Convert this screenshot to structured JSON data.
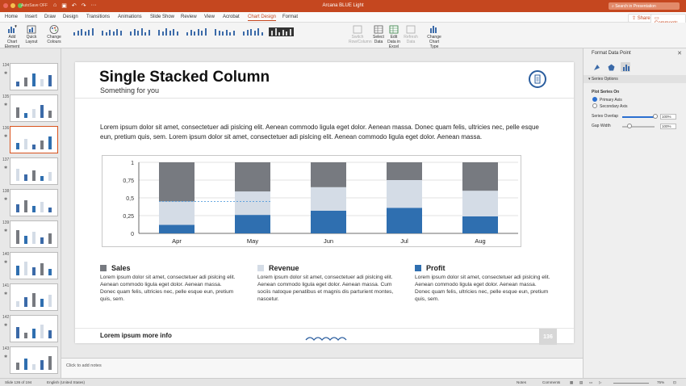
{
  "window": {
    "title": "Arcana BLUE Light",
    "autosave_label": "AutoSave",
    "autosave_state": "OFF",
    "search_placeholder": "Search in Presentation",
    "share_label": "Share",
    "comments_label": "Comments"
  },
  "tabs": [
    "Home",
    "Insert",
    "Draw",
    "Design",
    "Transitions",
    "Animations",
    "Slide Show",
    "Review",
    "View",
    "Acrobat",
    "Chart Design",
    "Format"
  ],
  "active_tab": "Chart Design",
  "ribbon": {
    "add_chart_element": "Add Chart Element",
    "quick_layout": "Quick Layout",
    "change_colours": "Change Colours",
    "switch_row_column": "Switch Row/Column",
    "select_data": "Select Data",
    "edit_data_in_excel": "Edit Data in Excel",
    "refresh_data": "Refresh Data",
    "change_chart_type": "Change Chart Type"
  },
  "thumbnails": [
    {
      "num": "134",
      "star": "✱"
    },
    {
      "num": "135",
      "star": "✱"
    },
    {
      "num": "136",
      "star": "✱",
      "selected": true
    },
    {
      "num": "137",
      "star": "✱"
    },
    {
      "num": "138",
      "star": "✱"
    },
    {
      "num": "139",
      "star": "✱"
    },
    {
      "num": "140",
      "star": "✱"
    },
    {
      "num": "141",
      "star": "✱"
    },
    {
      "num": "142",
      "star": "✱"
    },
    {
      "num": "143",
      "star": "✱"
    }
  ],
  "slide": {
    "title": "Single Stacked Column",
    "subtitle": "Something for you",
    "body": "Lorem ipsum dolor sit amet, consectetuer adi pislcing elit. Aenean commodo ligula eget dolor. Aenean massa. Donec quam felis, ultricies nec, pelle esque eun, pretium quis, sem. Lorem ipsum dolor sit amet, consectetuer adi pislcing elit. Aenean commodo ligula eget dolor. Aenean massa.",
    "footer": "Lorem ipsum more info",
    "page_number": "136",
    "legend": [
      {
        "name": "Sales",
        "color": "#777a80",
        "text": "Lorem ipsum dolor sit amet, consectetuer adi pislcing elit. Aenean commodo ligula eget dolor. Aenean massa. Donec quam felis, ultricies nec, pelle esque eun, pretium quis, sem."
      },
      {
        "name": "Revenue",
        "color": "#d4dce6",
        "text": "Lorem ipsum dolor sit amet, consectetuer adi pislcing elit. Aenean commodo ligula eget dolor. Aenean massa. Cum sociis natoque penatibus et magnis dis parturient montes, nascetur."
      },
      {
        "name": "Profit",
        "color": "#2f6fb0",
        "text": "Lorem ipsum dolor sit amet, consectetuer adi pislcing elit. Aenean commodo ligula eget dolor. Aenean massa. Donec quam felis, ultricies nec, pelle esque eun, pretium quis, sem."
      }
    ]
  },
  "chart_data": {
    "type": "bar",
    "stacked": true,
    "categories": [
      "Apr",
      "May",
      "Jun",
      "Jul",
      "Aug"
    ],
    "series": [
      {
        "name": "Profit",
        "color": "#2f6fb0",
        "values": [
          0.12,
          0.26,
          0.32,
          0.36,
          0.24
        ]
      },
      {
        "name": "Revenue",
        "color": "#d4dce6",
        "values": [
          0.33,
          0.33,
          0.33,
          0.39,
          0.36
        ]
      },
      {
        "name": "Sales",
        "color": "#777a80",
        "values": [
          0.55,
          0.41,
          0.35,
          0.25,
          0.4
        ]
      }
    ],
    "yticks": [
      "0",
      "0,25",
      "0,5",
      "0,75",
      "1"
    ],
    "ylim": [
      0,
      1
    ],
    "grid": true
  },
  "notes_placeholder": "Click to add notes",
  "format_panel": {
    "title": "Format Data Point",
    "section": "Series Options",
    "plot_series_on": "Plot Series On",
    "primary_axis": "Primary Axis",
    "secondary_axis": "Secondary Axis",
    "series_overlap_label": "Series Overlap",
    "series_overlap_value": "100%",
    "gap_width_label": "Gap Width",
    "gap_width_value": "100%"
  },
  "status": {
    "slide_info": "Slide 136 of 194",
    "language": "English (United States)",
    "notes": "Notes",
    "comments": "Comments",
    "zoom": "75%"
  }
}
